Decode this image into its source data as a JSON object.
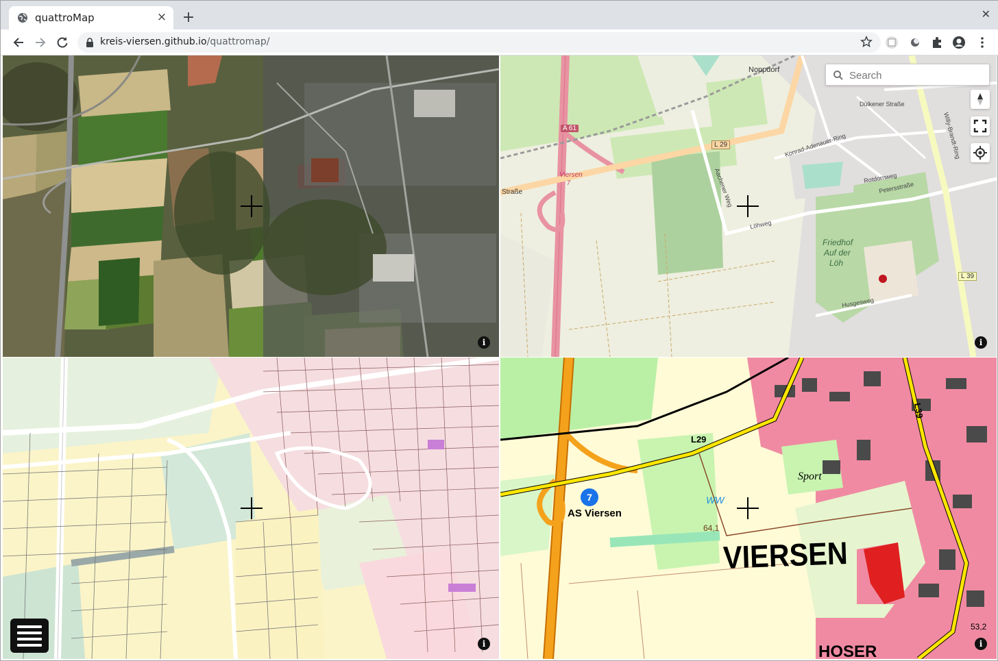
{
  "browser": {
    "tab_title": "quattroMap",
    "tab_close": "×",
    "new_tab": "+",
    "window_close": "✕",
    "url_host": "kreis-viersen.github.io",
    "url_path": "/quattromap/"
  },
  "icons": {
    "favicon": "globe-icon",
    "back": "arrow-left-icon",
    "forward": "arrow-right-icon",
    "reload": "reload-icon",
    "lock": "lock-icon",
    "bookmark": "star-icon",
    "extensions": "puzzle-icon",
    "profile": "avatar-icon",
    "menu": "kebab-menu-icon"
  },
  "map": {
    "search_placeholder": "Search",
    "info_label": "i",
    "osm_labels": {
      "noppdorf": "Noppdorf",
      "a61": "A 61",
      "l29": "L 29",
      "l39": "L 39",
      "viersen": "Viersen",
      "exit_num": "7",
      "strasse": "Straße",
      "friedhof1": "Friedhof",
      "friedhof2": "Auf der",
      "friedhof3": "Löh",
      "dulkener": "Dülkener Straße",
      "adenauer": "Konrad-Adenauer-Ring",
      "loehweg": "Löhweg",
      "aachener": "Aachener Weg",
      "petersstr": "Petersstraße",
      "husgesweg": "Husgesweg",
      "willy": "Willy-Brandt-Ring",
      "rotdornweg": "Rotdornweg"
    },
    "topo_labels": {
      "viersen": "VIERSEN",
      "as_viersen": "AS Viersen",
      "exit_num": "7",
      "l29": "L29",
      "l39": "L39",
      "sport": "Sport",
      "ww": "WW",
      "height1": "64,1",
      "height2": "53,2",
      "hoser": "HOSER"
    }
  },
  "colors": {
    "accent": "#1a73e8",
    "road_motorway": "#e892a2",
    "road_primary": "#fcd6a4",
    "topo_motorway": "#f4a21c",
    "topo_urban": "#e8547a",
    "topo_yellow_road": "#ffe600"
  }
}
